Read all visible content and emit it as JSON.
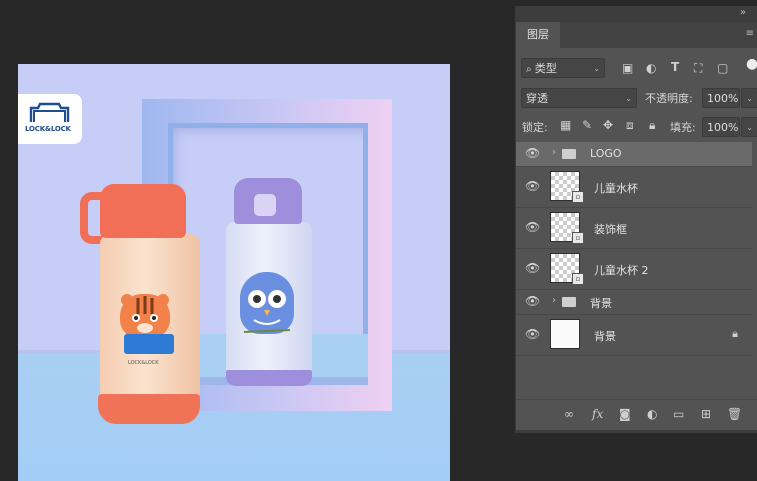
{
  "canvas": {
    "logo_text": "LOCK&LOCK",
    "bottle_brand": "LOCK&LOCK"
  },
  "panel": {
    "tab_label": "图层",
    "filter_kind": "类型",
    "blend_mode": "穿透",
    "opacity_label": "不透明度:",
    "opacity_value": "100%",
    "lock_label": "锁定:",
    "fill_label": "填充:",
    "fill_value": "100%",
    "layers": [
      {
        "name": "LOGO",
        "type": "group",
        "visible": true,
        "selected": true
      },
      {
        "name": "儿童水杯",
        "type": "smart",
        "visible": true
      },
      {
        "name": "装饰框",
        "type": "smart",
        "visible": true
      },
      {
        "name": "儿童水杯 2",
        "type": "smart",
        "visible": true
      },
      {
        "name": "背景",
        "type": "group",
        "visible": true
      },
      {
        "name": "背景",
        "type": "background",
        "visible": true,
        "locked": true
      }
    ]
  },
  "icons": {
    "collapse": "double-chevron-icon",
    "eye": "eye-icon",
    "lock": "lock-icon",
    "link": "link-icon",
    "fx": "fx-icon",
    "mask": "mask-icon",
    "adjustment": "adjustment-icon",
    "new_group": "folder-icon",
    "new_layer": "new-layer-icon",
    "trash": "trash-icon"
  },
  "colors": {
    "canvas_bg": "#c6cdf7",
    "panel_bg": "#535353",
    "app_bg": "#282828"
  }
}
